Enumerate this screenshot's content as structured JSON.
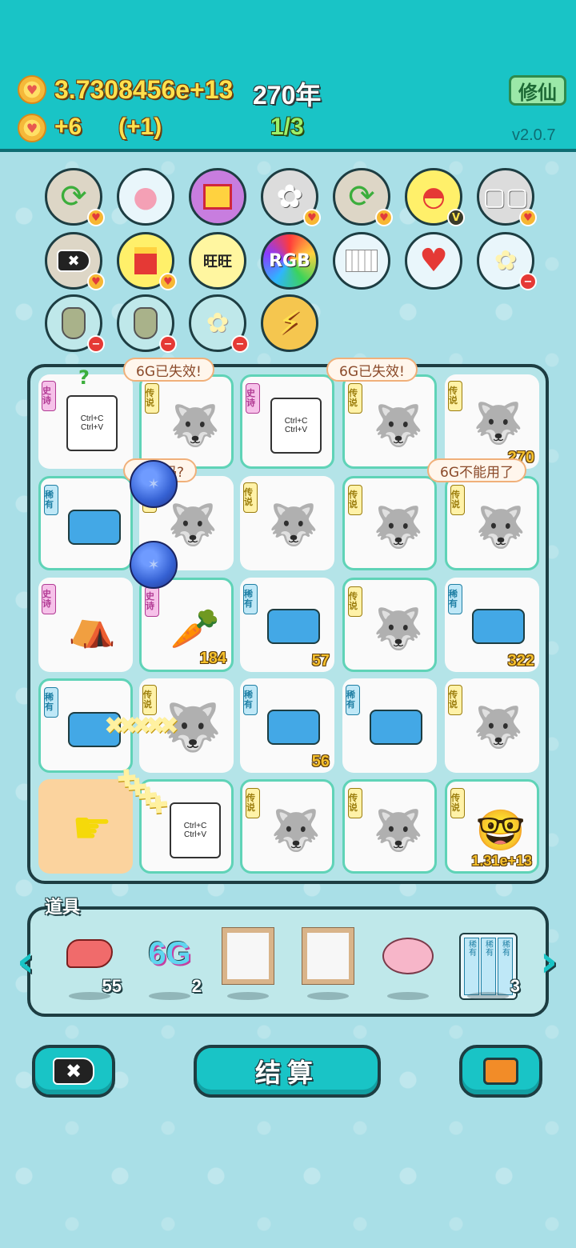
{
  "header": {
    "gold": "3.7308456e+13",
    "year": "270年",
    "income": "+6",
    "income_bonus": "(+1)",
    "progress": "1/3",
    "xiuxian_label": "修仙",
    "version": "v2.0.7"
  },
  "buff_icons": [
    {
      "icon": "refresh-icon",
      "glyph": "⟳"
    },
    {
      "icon": "piggy-bank-icon",
      "glyph": "🐷"
    },
    {
      "icon": "gift-box-icon",
      "glyph": "🎁"
    },
    {
      "icon": "bunny-icon",
      "glyph": "🐰"
    },
    {
      "icon": "refresh-icon",
      "glyph": "⟳"
    },
    {
      "icon": "fruit-bowl-icon",
      "glyph": "🍉"
    },
    {
      "icon": "sugar-cubes-icon",
      "glyph": "▢"
    },
    {
      "icon": "delete-tag-icon",
      "glyph": "✖"
    },
    {
      "icon": "fries-icon",
      "glyph": "🍟"
    },
    {
      "icon": "wang-text-icon",
      "glyph": "旺"
    },
    {
      "icon": "rgb-icon",
      "glyph": "RGB"
    },
    {
      "icon": "pleated-skirt-icon",
      "glyph": "▥"
    },
    {
      "icon": "heart-fan-icon",
      "glyph": "❤"
    },
    {
      "icon": "potted-flower-icon",
      "glyph": "✿"
    },
    {
      "icon": "money-bag-icon",
      "glyph": "💰"
    },
    {
      "icon": "money-bag-icon",
      "glyph": "💰"
    },
    {
      "icon": "potted-flower-icon",
      "glyph": "✿"
    },
    {
      "icon": "lightning-icon",
      "glyph": "⚡"
    }
  ],
  "bubbles": {
    "b1": "6G已失效!",
    "b2": "6G已失效!",
    "b3": "费了吗?",
    "b4": "6G不能用了"
  },
  "tags": {
    "epic": "史诗",
    "legend": "传说",
    "rare": "稀有"
  },
  "board_numbers": {
    "carrot": "184",
    "printer_r3c3": "57",
    "printer_r3c5": "322",
    "printer_r4c3": "56",
    "glasses_man": "1.31e+13",
    "r1c5": "270"
  },
  "copy_paste": {
    "line1": "Ctrl+C",
    "line2": "Ctrl+V"
  },
  "items_panel": {
    "title": "道具",
    "liver_count": "55",
    "sixg_label": "6G",
    "sixg_count": "2",
    "capsule_count": "3",
    "capsule_text": "稀有"
  },
  "bottom": {
    "settle_label": "结算"
  },
  "colors": {
    "header_bg": "#19c4c6",
    "body_bg": "#a9dfe7",
    "gold_text": "#ffe14d",
    "green_text": "#9cf06a"
  }
}
